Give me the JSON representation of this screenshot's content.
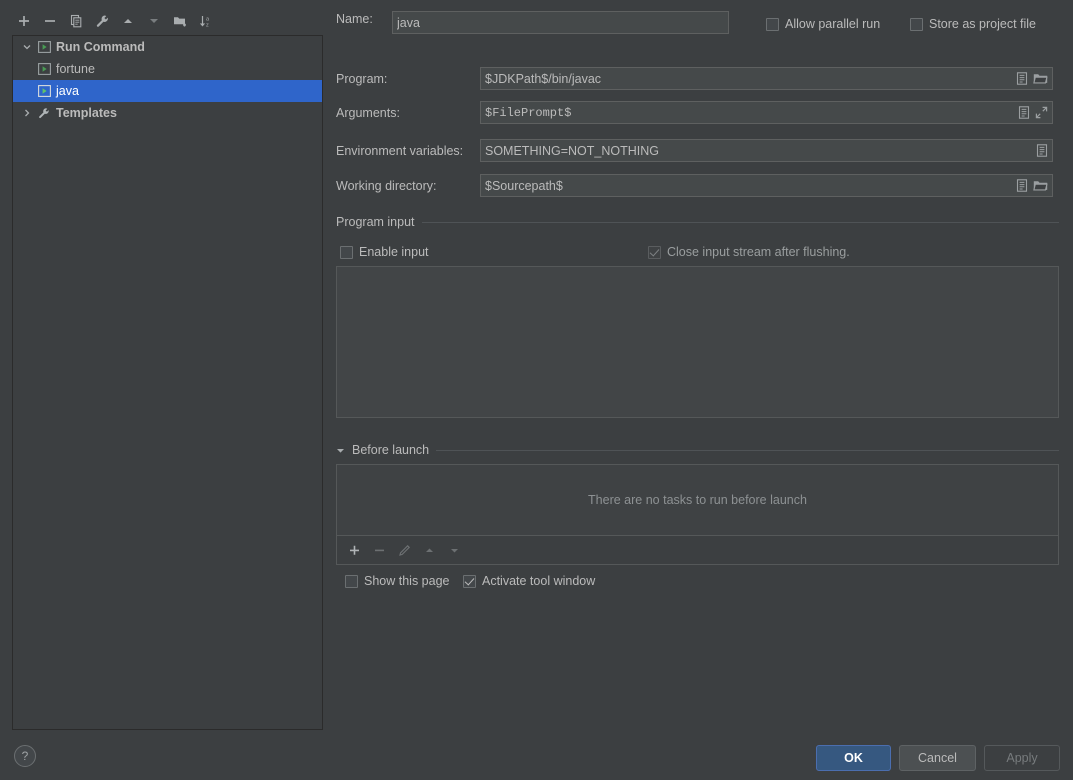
{
  "colors": {
    "background": "#3c3f41",
    "selection_blue": "#2f65ca",
    "default_button_blue": "#365880",
    "text": "#bbbbbb",
    "play_green": "#499c54"
  },
  "tree_toolbar": {
    "buttons": [
      {
        "name": "add-icon",
        "label": "Add New Configuration"
      },
      {
        "name": "remove-icon",
        "label": "Remove Configuration"
      },
      {
        "name": "copy-icon",
        "label": "Copy Configuration"
      },
      {
        "name": "edit-templates-icon",
        "label": "Edit Templates"
      },
      {
        "name": "move-up-icon",
        "label": "Move Up"
      },
      {
        "name": "move-down-icon",
        "label": "Move Down"
      },
      {
        "name": "new-folder-icon",
        "label": "Create New Folder"
      },
      {
        "name": "sort-alphabetically-icon",
        "label": "Sort Configurations"
      }
    ]
  },
  "tree": {
    "nodes": [
      {
        "label": "Run Command",
        "level": 0,
        "twisty": "expanded",
        "icon": "run-configuration-icon",
        "bold": true,
        "selected": false
      },
      {
        "label": "fortune",
        "level": 1,
        "twisty": "none",
        "icon": "run-configuration-icon",
        "bold": false,
        "selected": false
      },
      {
        "label": "java",
        "level": 1,
        "twisty": "none",
        "icon": "run-configuration-icon",
        "bold": false,
        "selected": true
      },
      {
        "label": "Templates",
        "level": 0,
        "twisty": "collapsed",
        "icon": "wrench-icon",
        "bold": true,
        "selected": false
      }
    ]
  },
  "help_button": {
    "glyph": "?"
  },
  "form": {
    "name": {
      "label": "Name:",
      "value": "java",
      "placeholder": ""
    },
    "allow_parallel_run": {
      "label": "Allow parallel run",
      "checked": false
    },
    "store_as_project_file": {
      "label": "Store as project file",
      "checked": false,
      "gear_icon": "gear-icon"
    },
    "program": {
      "label": "Program:",
      "value": "$JDKPath$/bin/javac",
      "icons": [
        "insert-macro-icon",
        "browse-folder-icon"
      ]
    },
    "arguments": {
      "label": "Arguments:",
      "value": "$FilePrompt$",
      "icons": [
        "insert-macro-icon",
        "expand-editor-icon"
      ]
    },
    "environment_variables": {
      "label": "Environment variables:",
      "value": "SOMETHING=NOT_NOTHING",
      "icons": [
        "insert-macro-icon"
      ]
    },
    "working_directory": {
      "label": "Working directory:",
      "value": "$Sourcepath$",
      "icons": [
        "insert-macro-icon",
        "browse-folder-icon"
      ]
    }
  },
  "program_input": {
    "group_title": "Program input",
    "enable_input": {
      "label": "Enable input",
      "checked": false,
      "disabled": false
    },
    "close_stream": {
      "label": "Close input stream after flushing.",
      "checked": true,
      "disabled": true
    },
    "textarea_value": ""
  },
  "before_launch": {
    "group_title": "Before launch",
    "collapse_icon": "triangle-down-icon",
    "empty_message": "There are no tasks to run before launch",
    "toolbar": [
      {
        "name": "add-task-icon",
        "label": "Add",
        "disabled": false
      },
      {
        "name": "remove-task-icon",
        "label": "Remove",
        "disabled": true
      },
      {
        "name": "edit-task-icon",
        "label": "Edit",
        "disabled": true
      },
      {
        "name": "move-task-up-icon",
        "label": "Move Up",
        "disabled": true
      },
      {
        "name": "move-task-down-icon",
        "label": "Move Down",
        "disabled": true
      }
    ],
    "show_this_page": {
      "label": "Show this page",
      "checked": false
    },
    "activate_tool_window": {
      "label": "Activate tool window",
      "checked": true
    }
  },
  "dialog_buttons": {
    "ok": "OK",
    "cancel": "Cancel",
    "apply": "Apply"
  }
}
